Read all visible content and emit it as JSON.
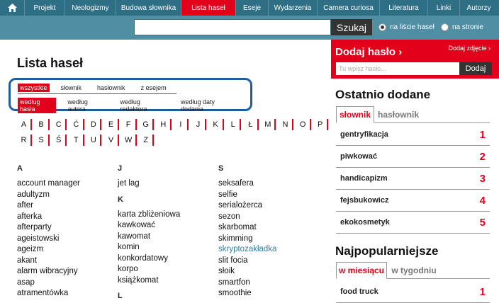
{
  "nav": {
    "home_icon": "home-icon",
    "items": [
      {
        "label": "Projekt",
        "active": false
      },
      {
        "label": "Neologizmy",
        "active": false
      },
      {
        "label": "Budowa słownika",
        "active": false
      },
      {
        "label": "Lista haseł",
        "active": true
      },
      {
        "label": "Eseje",
        "active": false
      },
      {
        "label": "Wydarzenia",
        "active": false
      },
      {
        "label": "Camera curiosa",
        "active": false
      },
      {
        "label": "Literatura",
        "active": false
      },
      {
        "label": "Linki",
        "active": false
      },
      {
        "label": "Autorzy",
        "active": false
      }
    ]
  },
  "search": {
    "value": "",
    "button": "Szukaj",
    "options": [
      {
        "label": "na liście haseł",
        "checked": true
      },
      {
        "label": "na stronie",
        "checked": false
      }
    ]
  },
  "main": {
    "title": "Lista haseł",
    "filters_type": [
      "wszystkie",
      "słownik",
      "hasłownik",
      "z esejem"
    ],
    "filters_sort": [
      "według hasła",
      "według autora",
      "według redaktora",
      "według daty dodania"
    ],
    "letters_row1": [
      "A",
      "B",
      "C",
      "Ć",
      "D",
      "E",
      "F",
      "G",
      "H",
      "I",
      "J",
      "K",
      "L",
      "Ł",
      "M",
      "N",
      "O",
      "P"
    ],
    "letters_row2": [
      "R",
      "S",
      "Ś",
      "T",
      "U",
      "V",
      "W",
      "Z"
    ],
    "col1": {
      "head": "A",
      "entries": [
        "account manager",
        "adultyzm",
        "after",
        "afterka",
        "afterparty",
        "ageistowski",
        "ageizm",
        "akant",
        "alarm wibracyjny",
        "asap",
        "atramentówka"
      ]
    },
    "col2": {
      "groups": [
        {
          "head": "J",
          "entries": [
            "jet lag"
          ]
        },
        {
          "head": "K",
          "entries": [
            "karta zbliżeniowa",
            "kawkować",
            "kawomat",
            "komin",
            "konkordatowy",
            "korpo",
            "książkomat"
          ]
        },
        {
          "head": "L",
          "entries": []
        }
      ]
    },
    "col3": {
      "head": "S",
      "entries": [
        "seksafera",
        "selfie",
        "serialożerca",
        "sezon",
        "skarbomat",
        "skimming",
        "skryptozakładka",
        "slit focia",
        "słoik",
        "smartfon",
        "smoothie"
      ],
      "link_entry": "skryptozakładka"
    }
  },
  "sidebar": {
    "add": {
      "title": "Dodaj hasło",
      "photo_link": "Dodaj zdjęcie",
      "input_placeholder": "Tu wpisz hasło...",
      "button": "Dodaj"
    },
    "recent": {
      "title": "Ostatnio dodane",
      "tabs": [
        {
          "label": "słownik",
          "active": true
        },
        {
          "label": "hasłownik",
          "active": false
        }
      ],
      "items": [
        {
          "word": "gentryfikacja",
          "rank": "1"
        },
        {
          "word": "piwkować",
          "rank": "2"
        },
        {
          "word": "handicapizm",
          "rank": "3"
        },
        {
          "word": "fejsbukowicz",
          "rank": "4"
        },
        {
          "word": "ekokosmetyk",
          "rank": "5"
        }
      ]
    },
    "popular": {
      "title": "Najpopularniejsze",
      "tabs": [
        {
          "label": "w miesiącu",
          "active": true
        },
        {
          "label": "w tygodniu",
          "active": false
        }
      ],
      "items": [
        {
          "word": "food truck",
          "rank": "1"
        }
      ]
    }
  },
  "colors": {
    "accent": "#e3001b",
    "nav": "#2f6f86",
    "band": "#4f8ea3",
    "link": "#2f7f9e",
    "filter_border": "#1f5e9e"
  }
}
